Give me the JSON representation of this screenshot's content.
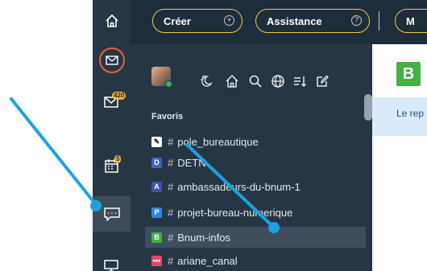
{
  "topbar": {
    "create_label": "Créer",
    "create_icon": "plus-circle-icon",
    "help_label": "Assistance",
    "help_icon": "question-circle-icon",
    "more_label": "M"
  },
  "rail": {
    "items": [
      {
        "name": "home-icon"
      },
      {
        "name": "recent-mail-icon"
      },
      {
        "name": "mail-icon",
        "badge": "420"
      },
      {
        "name": "calendar-icon",
        "badge": "5"
      },
      {
        "name": "chat-icon"
      },
      {
        "name": "desktop-icon"
      }
    ]
  },
  "panel": {
    "toolbar_icons": [
      "night-mode-icon",
      "home-icon",
      "search-icon",
      "globe-icon",
      "sort-icon",
      "edit-icon"
    ],
    "section_label": "Favoris",
    "rooms": [
      {
        "label": "pole_bureautique",
        "icon_letter": "",
        "icon_color": "#ffffff"
      },
      {
        "label": "DETN",
        "icon_letter": "D",
        "icon_color": "#3b63c8"
      },
      {
        "label": "ambassadeurs-du-bnum-1",
        "icon_letter": "A",
        "icon_color": "#3d52b5"
      },
      {
        "label": "projet-bureau-numerique",
        "icon_letter": "P",
        "icon_color": "#2f86e0"
      },
      {
        "label": "Bnum-infos",
        "icon_letter": "B",
        "icon_color": "#46b044"
      },
      {
        "label": "ariane_canal",
        "icon_letter": "",
        "icon_color": "#e24a68"
      }
    ]
  },
  "content": {
    "room_letter": "B",
    "info_text": "Le rep"
  },
  "colors": {
    "accent_yellow": "#f2c94c",
    "arrow_blue": "#1aa3e0",
    "rail_bg": "#263645",
    "topbar_bg": "#1e2d3b"
  }
}
